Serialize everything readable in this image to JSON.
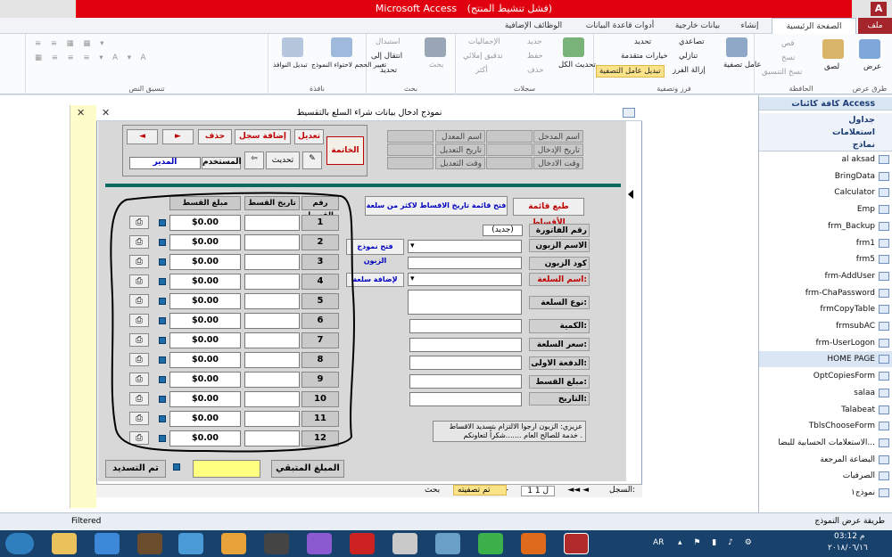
{
  "window": {
    "title": "Microsoft Access",
    "subtitle": "(فشل تنشيط المنتج)",
    "app_icon": "A"
  },
  "ribbon_tabs": [
    "ملف",
    "الصفحة الرئيسية",
    "إنشاء",
    "بيانات خارجية",
    "أدوات قاعدة البيانات",
    "الوظائف الإضافية"
  ],
  "ribbon": {
    "views": {
      "label": "طرق عرض",
      "button": "عرض"
    },
    "clipboard": {
      "label": "الحافظة",
      "paste": "لصق",
      "cut": "قص",
      "copy": "نسخ",
      "format_painter": "نسخ التنسيق"
    },
    "sort_filter": {
      "label": "فرز وتصفية",
      "filter": "عامل تصفية",
      "ascending": "تصاعدي",
      "descending": "تنازلي",
      "remove_sort": "إزالة الفرز",
      "selection": "تحديد",
      "advanced": "خيارات متقدمة",
      "toggle_filter": "تبديل عامل التصفية"
    },
    "records": {
      "label": "سجلات",
      "refresh_all": "تحديث الكل",
      "new": "جديد",
      "save": "حفظ",
      "delete": "حذف",
      "totals": "الإجماليات",
      "spelling": "تدقيق إملائي",
      "more": "أكثر"
    },
    "find": {
      "label": "بحث",
      "find": "بحث",
      "replace": "استبدال",
      "goto": "انتقال إلى",
      "select": "تحديد"
    },
    "window": {
      "label": "نافذة",
      "size_to_fit": "تغيير الحجم لاحتواء النموذج",
      "switch": "تبديل النوافذ"
    },
    "text_format": {
      "label": "تنسيق النص"
    }
  },
  "form": {
    "title": "نموذج ادخال بيانات شراء السلع بالتقسيط",
    "nav_buttons": {
      "edit": "تعديل",
      "add_record": "إضافة سجل",
      "delete": "حذف",
      "next": "►",
      "prev": "◄",
      "close": "الخاتمة",
      "refresh": "تحديث",
      "user_label": "المستخدم",
      "user_value": "المدير"
    },
    "audit": {
      "entered_by": "اسم المدخل",
      "entered_date": "تاريخ الإدخال",
      "entered_time": "وقت الادخال",
      "modified_by": "اسم المعدل",
      "modified_date": "تاريخ التعديل",
      "modified_time": "وقت التعديل"
    },
    "buttons": {
      "print_installments": "طبع قائمة الأقساط",
      "open_installment_list": "فتح قائمة تاريخ الاقساط لاكثر من سلعة",
      "open_customer_form": "فتح نموذج الزبون",
      "add_item": "لإضافة سلعة"
    },
    "fields": {
      "invoice_no": "رقم الفاتورة",
      "invoice_value": "(جديد)",
      "customer_name": "الاسم الزبون",
      "customer_code": "كود الزبون",
      "item_name": "اسم السلعة:",
      "item_type": "نوع السلعة:",
      "quantity": "الكمية:",
      "item_price": "سعر السلعة:",
      "down_payment": "الدفعة الاولى:",
      "installment_amount": "مبلغ القسط:",
      "date": "التاريخ:"
    },
    "note": "عزيزي: الزبون ارجوا الالتزام بتسديد الاقساط خدمة للصالح العام .......شكراً لتعاونكم .",
    "installments_headers": {
      "no": "رقم القسط",
      "date": "تاريخ القسط",
      "amount": "مبلغ القسط"
    },
    "installments": [
      {
        "no": "1",
        "date": "",
        "amount": "$0.00"
      },
      {
        "no": "2",
        "date": "",
        "amount": "$0.00"
      },
      {
        "no": "3",
        "date": "",
        "amount": "$0.00"
      },
      {
        "no": "4",
        "date": "",
        "amount": "$0.00"
      },
      {
        "no": "5",
        "date": "",
        "amount": "$0.00"
      },
      {
        "no": "6",
        "date": "",
        "amount": "$0.00"
      },
      {
        "no": "7",
        "date": "",
        "amount": "$0.00"
      },
      {
        "no": "8",
        "date": "",
        "amount": "$0.00"
      },
      {
        "no": "9",
        "date": "",
        "amount": "$0.00"
      },
      {
        "no": "10",
        "date": "",
        "amount": "$0.00"
      },
      {
        "no": "11",
        "date": "",
        "amount": "$0.00"
      },
      {
        "no": "12",
        "date": "",
        "amount": "$0.00"
      }
    ],
    "remaining_label": "المبلغ المتبقي",
    "paid_label": "تم التسديد",
    "record_nav": {
      "label": "السجل:",
      "current": "1 ل 1",
      "filtered": "تم تصفيته",
      "search": "بحث"
    }
  },
  "nav_pane": {
    "title": "كافة كائنات Access",
    "groups": [
      "جداول",
      "استعلامات",
      "نماذج"
    ],
    "items": [
      "al aksad",
      "BringData",
      "Calculator",
      "Emp",
      "frm_Backup",
      "frm1",
      "frm5",
      "frm-AddUser",
      "frm-ChaPassword",
      "frmCopyTable",
      "frmsubAC",
      "frm-UserLogon",
      "HOME PAGE",
      "OptCopiesForm",
      "salaa",
      "Talabeat",
      "TblsChooseForm",
      "الاستعلامات الحسابية للبضا...",
      "البضاعة المرجعة",
      "الصرفيات",
      "نموذج١"
    ]
  },
  "statusbar": {
    "left": "Filtered",
    "right": "طريقة عرض النموذج"
  },
  "taskbar": {
    "lang": "AR",
    "time": "03:12 م",
    "date": "٢٠١٨/٠٦/١٦"
  }
}
